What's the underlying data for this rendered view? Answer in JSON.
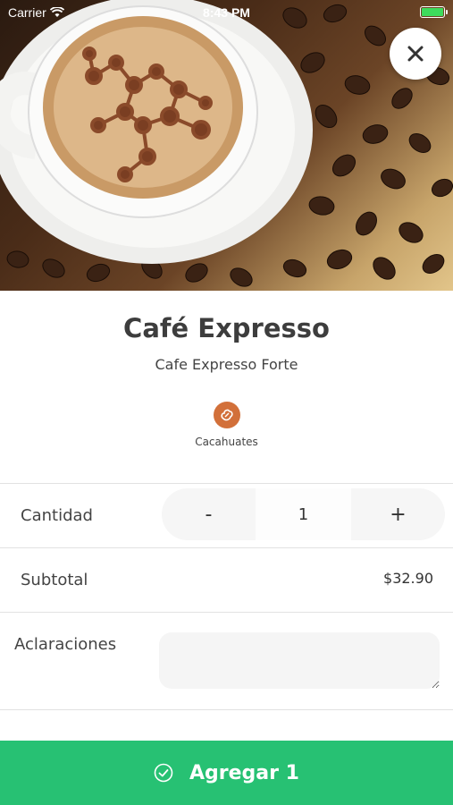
{
  "status_bar": {
    "carrier": "Carrier",
    "time": "8:43 PM"
  },
  "product": {
    "name": "Café Expresso",
    "description": "Cafe Expresso Forte",
    "allergens": [
      {
        "label": "Cacahuates",
        "icon": "peanut-icon",
        "color": "#d2703a"
      }
    ]
  },
  "quantity": {
    "label": "Cantidad",
    "decrement": "-",
    "value": "1",
    "increment": "+"
  },
  "subtotal": {
    "label": "Subtotal",
    "value": "$32.90"
  },
  "notes": {
    "label": "Aclaraciones",
    "value": ""
  },
  "footer": {
    "add_label": "Agregar 1",
    "icon": "check-circle-icon",
    "color": "#27c173"
  },
  "close": {
    "icon": "close-icon"
  }
}
